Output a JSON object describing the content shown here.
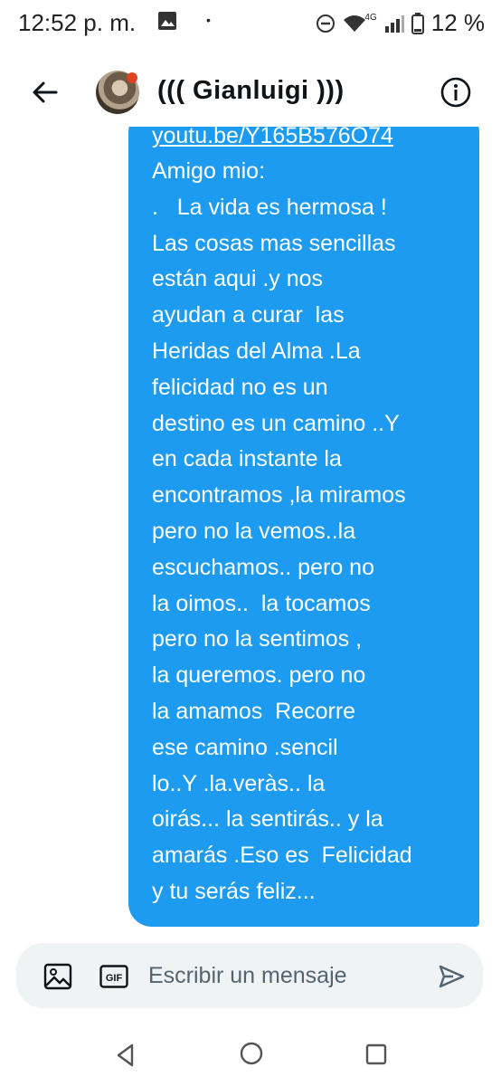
{
  "status_bar": {
    "time": "12:52 p. m.",
    "dot": "•",
    "network": "4G",
    "battery": "12 %"
  },
  "header": {
    "contact_name": "((( Gianluigi )))"
  },
  "message": {
    "link_text": "youtu.be/Y165B576O74",
    "lines": [
      "Amigo mio:",
      ".   La vida es hermosa !",
      "Las cosas mas sencillas",
      "están aqui .y nos",
      "ayudan a curar  las",
      "Heridas del Alma .La",
      "felicidad no es un",
      "destino es un camino ..Y",
      "en cada instante la",
      "encontramos ,la miramos",
      "pero no la vemos..la",
      "escuchamos.. pero no",
      "la oimos..  la tocamos",
      "pero no la sentimos ,",
      "la queremos. pero no",
      "la amamos  Recorre",
      "ese camino .sencil",
      "lo..Y .la.veràs.. la",
      "oirás... la sentirás.. y la",
      "amarás .Eso es  Felicidad",
      "y tu serás feliz..."
    ]
  },
  "composer": {
    "placeholder": "Escribir un mensaje",
    "gif_label": "GIF"
  },
  "colors": {
    "bubble": "#1d9bf0",
    "composer_bg": "#eff3f4",
    "text_primary": "#0f1419",
    "placeholder": "#536471"
  }
}
